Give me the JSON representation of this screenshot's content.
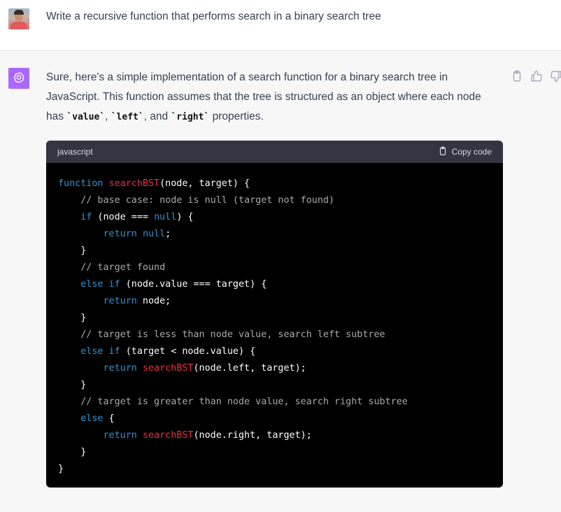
{
  "user": {
    "message": "Write a recursive function that performs search in a binary search tree"
  },
  "assistant": {
    "intro_1": "Sure, here's a simple implementation of a search function for a binary search tree in JavaScript. This function assumes that the tree is structured as an object where each node has ",
    "prop_value": "`value`",
    "sep_1": ", ",
    "prop_left": "`left`",
    "sep_2": ", and ",
    "prop_right": "`right`",
    "intro_end": " properties.",
    "code": {
      "language": "javascript",
      "copy_label": "Copy code",
      "lines": {
        "l1_kw": "function",
        "l1_fn": "searchBST",
        "l1_rest": "(node, target) {",
        "l2": "    // base case: node is null (target not found)",
        "l3_kw": "if",
        "l3_a": " (node === ",
        "l3_null": "null",
        "l3_b": ") {",
        "l4_kw": "return",
        "l4_null": "null",
        "l4_end": ";",
        "l5": "    }",
        "l6": "    // target found",
        "l7_kw": "else if",
        "l7_rest": " (node.value === target) {",
        "l8_kw": "return",
        "l8_rest": " node;",
        "l9": "    }",
        "l10": "    // target is less than node value, search left subtree",
        "l11_kw": "else if",
        "l11_rest": " (target < node.value) {",
        "l12_kw": "return",
        "l12_fn": "searchBST",
        "l12_rest": "(node.left, target);",
        "l13": "    }",
        "l14": "    // target is greater than node value, search right subtree",
        "l15_kw": "else",
        "l15_rest": " {",
        "l16_kw": "return",
        "l16_fn": "searchBST",
        "l16_rest": "(node.right, target);",
        "l17": "    }",
        "l18": "}"
      }
    }
  },
  "icons": {
    "assistant_logo": "openai-logo-icon",
    "copy": "clipboard-icon",
    "thumbs_up": "thumbs-up-icon",
    "thumbs_down": "thumbs-down-icon"
  },
  "colors": {
    "assistant_avatar": "#ab68ff",
    "keyword": "#2e95d3",
    "function_name": "#f22c3d",
    "comment": "#aaaaaa"
  }
}
